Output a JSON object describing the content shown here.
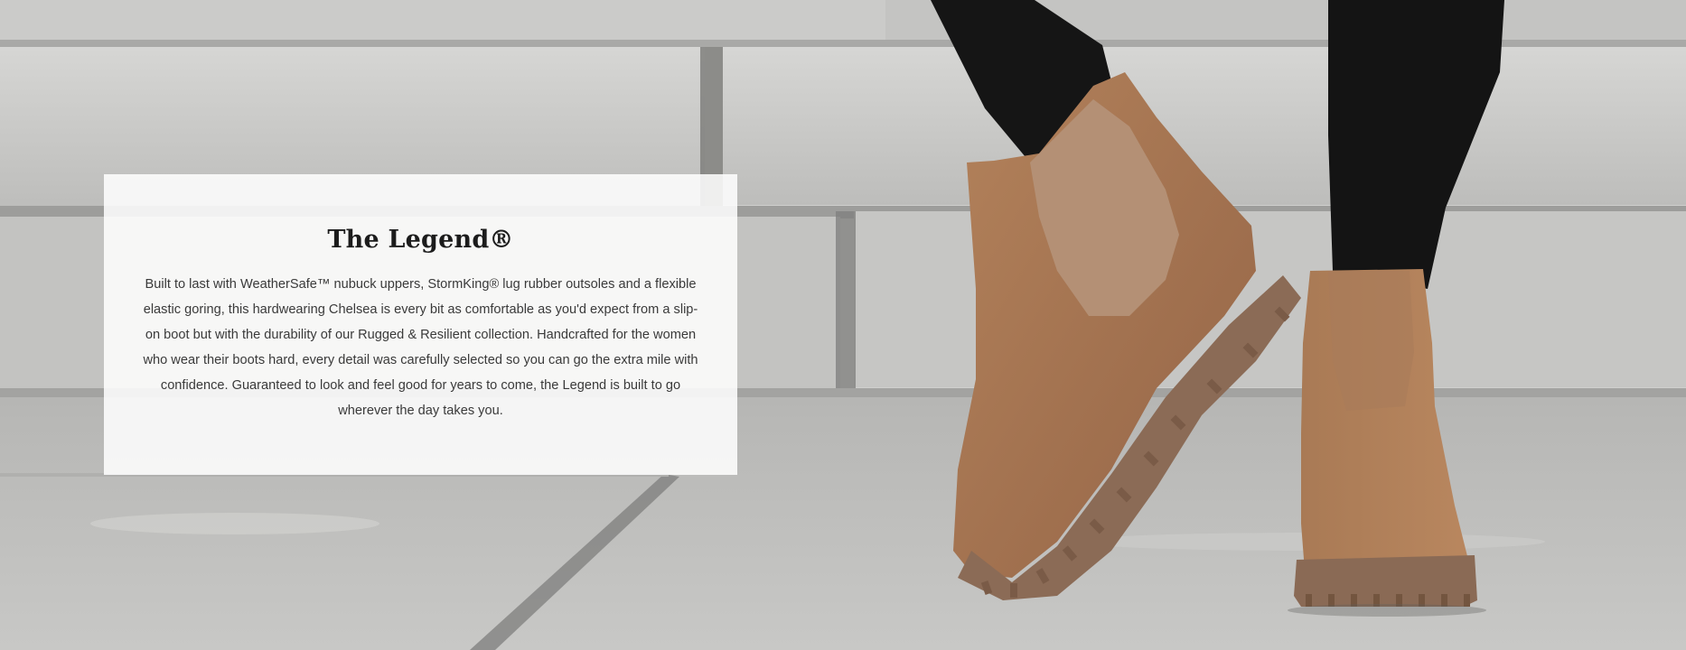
{
  "feature": {
    "title": "The Legend®",
    "description": "Built to last with WeatherSafe™ nubuck uppers, StormKing® lug rubber outsoles and a flexible elastic goring, this hardwearing Chelsea is every bit as comfortable as you'd expect from a slip-on boot but with the durability of our Rugged & Resilient collection. Handcrafted for the women who wear their boots hard, every detail was carefully selected so you can go the extra mile with confidence. Guaranteed to look and feel good for years to come, the Legend is built to go wherever the day takes you."
  },
  "colors": {
    "stone": "#c9c9c7",
    "stone_dark": "#8f8f8d",
    "boot_leather": "#a87650",
    "boot_elastic": "#b08c70",
    "boot_sole": "#8a6a55",
    "pants": "#151515",
    "card_bg": "#ffffff"
  }
}
